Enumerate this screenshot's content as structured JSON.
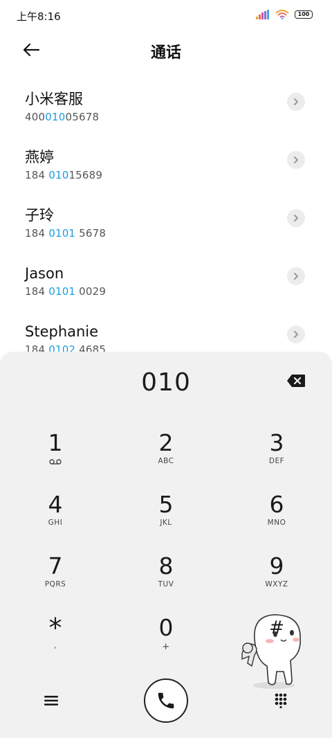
{
  "status": {
    "time": "上午8:16",
    "battery": "100"
  },
  "header": {
    "title": "通话"
  },
  "contacts": [
    {
      "name": "小米客服",
      "number_pre": "400",
      "number_match": "010",
      "number_post": "05678"
    },
    {
      "name": "燕婷",
      "number_pre": "184 ",
      "number_match": "010",
      "number_post": "15689"
    },
    {
      "name": "子玲",
      "number_pre": "184 ",
      "number_match": "0101",
      "number_post": " 5678"
    },
    {
      "name": "Jason",
      "number_pre": "184 ",
      "number_match": "0101",
      "number_post": " 0029"
    },
    {
      "name": "Stephanie",
      "number_pre": "184 ",
      "number_match": "0102",
      "number_post": " 4685"
    }
  ],
  "dialpad": {
    "display": "010",
    "keys": [
      {
        "digit": "1",
        "letters": "",
        "icon": "voicemail-icon"
      },
      {
        "digit": "2",
        "letters": "ABC"
      },
      {
        "digit": "3",
        "letters": "DEF"
      },
      {
        "digit": "4",
        "letters": "GHI"
      },
      {
        "digit": "5",
        "letters": "JKL"
      },
      {
        "digit": "6",
        "letters": "MNO"
      },
      {
        "digit": "7",
        "letters": "PQRS"
      },
      {
        "digit": "8",
        "letters": "TUV"
      },
      {
        "digit": "9",
        "letters": "WXYZ"
      },
      {
        "digit": "*",
        "letters": ","
      },
      {
        "digit": "0",
        "letters": "+"
      },
      {
        "digit": "#",
        "letters": ""
      }
    ]
  },
  "colors": {
    "highlight": "#1a9de0",
    "dialpad_bg": "#f1f1f1",
    "text": "#111111"
  }
}
